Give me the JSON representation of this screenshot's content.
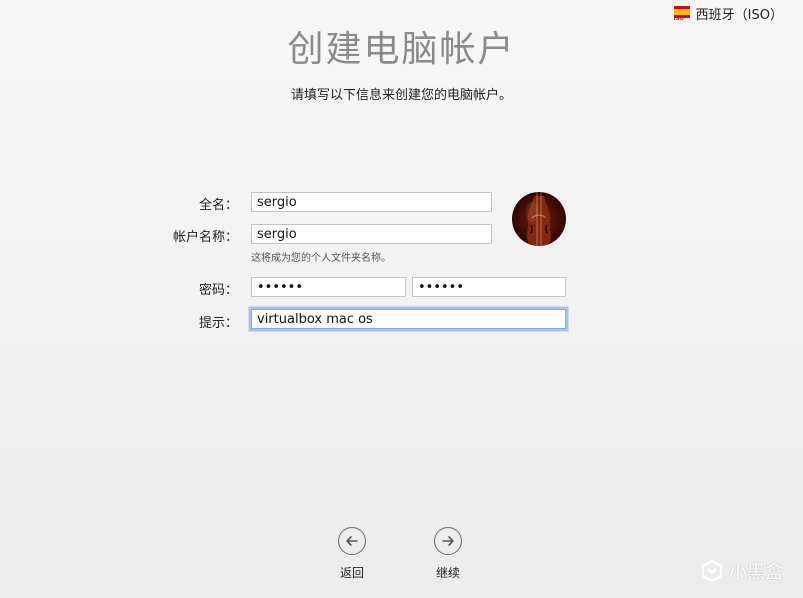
{
  "language_selector": {
    "label": "西班牙（ISO）",
    "flag": "spain-flag",
    "flag_text": "ISO"
  },
  "title": "创建电脑帐户",
  "subtitle": "请填写以下信息来创建您的电脑帐户。",
  "form": {
    "full_name": {
      "label": "全名：",
      "value": "sergio"
    },
    "account_name": {
      "label": "帐户名称：",
      "value": "sergio",
      "hint": "这将成为您的个人文件夹名称。"
    },
    "password": {
      "label": "密码：",
      "value": "••••••",
      "verify_value": "••••••"
    },
    "hint": {
      "label": "提示：",
      "value": "virtualbox mac os"
    }
  },
  "avatar": {
    "icon": "violin-avatar"
  },
  "nav": {
    "back_label": "返回",
    "continue_label": "继续"
  },
  "watermark": {
    "text": "小黑盒"
  },
  "colors": {
    "title": "#8a8a8a",
    "focus_ring": "#a6c1ec",
    "flag_red": "#c60b1e",
    "flag_yellow": "#f1bf00"
  }
}
